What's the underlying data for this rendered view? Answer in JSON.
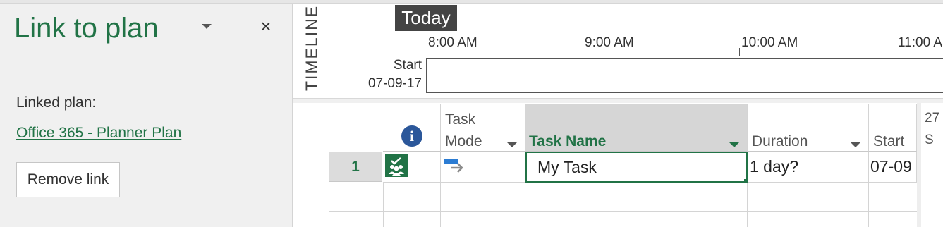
{
  "task_pane": {
    "title": "Link to plan",
    "linked_label": "Linked plan:",
    "linked_plan_name": "Office 365 - Planner Plan",
    "remove_button": "Remove link",
    "close_glyph": "×"
  },
  "timeline": {
    "side_label": "TIMELINE",
    "today_label": "Today",
    "ticks": [
      "8:00 AM",
      "9:00 AM",
      "10:00 AM",
      "11:00 A"
    ],
    "start_label": "Start",
    "start_date": "07-09-17"
  },
  "grid": {
    "columns": {
      "info_glyph": "i",
      "task_mode_line1": "Task",
      "task_mode_line2": "Mode",
      "task_name": "Task Name",
      "duration": "Duration",
      "start": "Start",
      "day_header_num": "27",
      "day_header_letter": "S"
    },
    "rows": [
      {
        "id": "1",
        "indicator_icon": "planner-linked-icon",
        "mode_icon": "auto-scheduled-icon",
        "name": "My Task",
        "duration": "1 day?",
        "start": "07-09"
      }
    ]
  },
  "colors": {
    "accent_green": "#217346",
    "info_blue": "#2b579a",
    "today_bg": "#444444",
    "header_selected_bg": "#d6d6d6"
  }
}
